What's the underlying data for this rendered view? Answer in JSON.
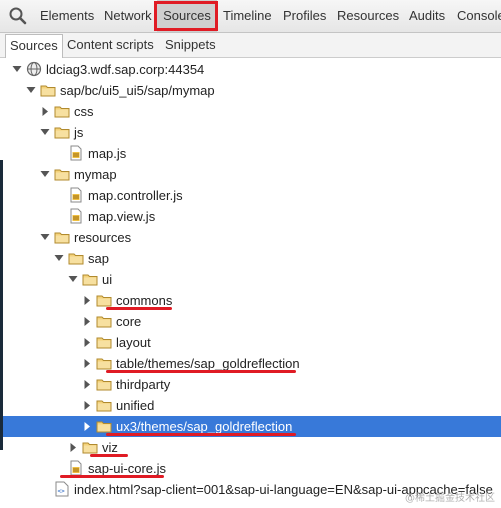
{
  "toolbar": {
    "tabs": [
      {
        "label": "Elements"
      },
      {
        "label": "Network"
      },
      {
        "label": "Sources"
      },
      {
        "label": "Timeline"
      },
      {
        "label": "Profiles"
      },
      {
        "label": "Resources"
      },
      {
        "label": "Audits"
      },
      {
        "label": "Console"
      }
    ],
    "active_tab": "Sources",
    "search_icon": "magnifier-icon"
  },
  "subtabs": [
    {
      "label": "Sources"
    },
    {
      "label": "Content scripts"
    },
    {
      "label": "Snippets"
    }
  ],
  "tree": [
    {
      "label": "ldciag3.wdf.sap.corp:44354",
      "icon": "globe-icon",
      "expanded": true
    },
    {
      "label": "sap/bc/ui5_ui5/sap/mymap",
      "icon": "folder-icon",
      "expanded": true
    },
    {
      "label": "css",
      "icon": "folder-icon",
      "expanded": false
    },
    {
      "label": "js",
      "icon": "folder-icon",
      "expanded": true
    },
    {
      "label": "map.js",
      "icon": "js-file-icon"
    },
    {
      "label": "mymap",
      "icon": "folder-icon",
      "expanded": true
    },
    {
      "label": "map.controller.js",
      "icon": "js-file-icon"
    },
    {
      "label": "map.view.js",
      "icon": "js-file-icon"
    },
    {
      "label": "resources",
      "icon": "folder-icon",
      "expanded": true
    },
    {
      "label": "sap",
      "icon": "folder-icon",
      "expanded": true
    },
    {
      "label": "ui",
      "icon": "folder-icon",
      "expanded": true
    },
    {
      "label": "commons",
      "icon": "folder-icon",
      "expanded": false
    },
    {
      "label": "core",
      "icon": "folder-icon",
      "expanded": false
    },
    {
      "label": "layout",
      "icon": "folder-icon",
      "expanded": false
    },
    {
      "label": "table/themes/sap_goldreflection",
      "icon": "folder-icon",
      "expanded": false
    },
    {
      "label": "thirdparty",
      "icon": "folder-icon",
      "expanded": false
    },
    {
      "label": "unified",
      "icon": "folder-icon",
      "expanded": false
    },
    {
      "label": "ux3/themes/sap_goldreflection",
      "icon": "folder-icon",
      "expanded": false,
      "selected": true
    },
    {
      "label": "viz",
      "icon": "folder-icon",
      "expanded": false
    },
    {
      "label": "sap-ui-core.js",
      "icon": "js-file-icon"
    },
    {
      "label": "index.html?sap-client=001&sap-ui-language=EN&sap-ui-appcache=false",
      "icon": "html-file-icon"
    }
  ],
  "watermark": "@稀土掘金技术社区",
  "colors": {
    "annotation_red": "#e01b24",
    "selection_blue": "#3879d9",
    "folder_yellow": "#f4d27a"
  }
}
